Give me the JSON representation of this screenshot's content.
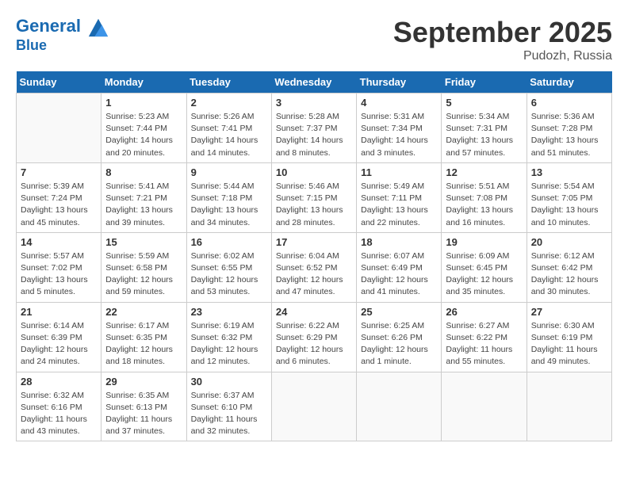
{
  "header": {
    "logo_line1": "General",
    "logo_line2": "Blue",
    "month": "September 2025",
    "location": "Pudozh, Russia"
  },
  "weekdays": [
    "Sunday",
    "Monday",
    "Tuesday",
    "Wednesday",
    "Thursday",
    "Friday",
    "Saturday"
  ],
  "weeks": [
    [
      {
        "day": "",
        "info": ""
      },
      {
        "day": "1",
        "info": "Sunrise: 5:23 AM\nSunset: 7:44 PM\nDaylight: 14 hours\nand 20 minutes."
      },
      {
        "day": "2",
        "info": "Sunrise: 5:26 AM\nSunset: 7:41 PM\nDaylight: 14 hours\nand 14 minutes."
      },
      {
        "day": "3",
        "info": "Sunrise: 5:28 AM\nSunset: 7:37 PM\nDaylight: 14 hours\nand 8 minutes."
      },
      {
        "day": "4",
        "info": "Sunrise: 5:31 AM\nSunset: 7:34 PM\nDaylight: 14 hours\nand 3 minutes."
      },
      {
        "day": "5",
        "info": "Sunrise: 5:34 AM\nSunset: 7:31 PM\nDaylight: 13 hours\nand 57 minutes."
      },
      {
        "day": "6",
        "info": "Sunrise: 5:36 AM\nSunset: 7:28 PM\nDaylight: 13 hours\nand 51 minutes."
      }
    ],
    [
      {
        "day": "7",
        "info": "Sunrise: 5:39 AM\nSunset: 7:24 PM\nDaylight: 13 hours\nand 45 minutes."
      },
      {
        "day": "8",
        "info": "Sunrise: 5:41 AM\nSunset: 7:21 PM\nDaylight: 13 hours\nand 39 minutes."
      },
      {
        "day": "9",
        "info": "Sunrise: 5:44 AM\nSunset: 7:18 PM\nDaylight: 13 hours\nand 34 minutes."
      },
      {
        "day": "10",
        "info": "Sunrise: 5:46 AM\nSunset: 7:15 PM\nDaylight: 13 hours\nand 28 minutes."
      },
      {
        "day": "11",
        "info": "Sunrise: 5:49 AM\nSunset: 7:11 PM\nDaylight: 13 hours\nand 22 minutes."
      },
      {
        "day": "12",
        "info": "Sunrise: 5:51 AM\nSunset: 7:08 PM\nDaylight: 13 hours\nand 16 minutes."
      },
      {
        "day": "13",
        "info": "Sunrise: 5:54 AM\nSunset: 7:05 PM\nDaylight: 13 hours\nand 10 minutes."
      }
    ],
    [
      {
        "day": "14",
        "info": "Sunrise: 5:57 AM\nSunset: 7:02 PM\nDaylight: 13 hours\nand 5 minutes."
      },
      {
        "day": "15",
        "info": "Sunrise: 5:59 AM\nSunset: 6:58 PM\nDaylight: 12 hours\nand 59 minutes."
      },
      {
        "day": "16",
        "info": "Sunrise: 6:02 AM\nSunset: 6:55 PM\nDaylight: 12 hours\nand 53 minutes."
      },
      {
        "day": "17",
        "info": "Sunrise: 6:04 AM\nSunset: 6:52 PM\nDaylight: 12 hours\nand 47 minutes."
      },
      {
        "day": "18",
        "info": "Sunrise: 6:07 AM\nSunset: 6:49 PM\nDaylight: 12 hours\nand 41 minutes."
      },
      {
        "day": "19",
        "info": "Sunrise: 6:09 AM\nSunset: 6:45 PM\nDaylight: 12 hours\nand 35 minutes."
      },
      {
        "day": "20",
        "info": "Sunrise: 6:12 AM\nSunset: 6:42 PM\nDaylight: 12 hours\nand 30 minutes."
      }
    ],
    [
      {
        "day": "21",
        "info": "Sunrise: 6:14 AM\nSunset: 6:39 PM\nDaylight: 12 hours\nand 24 minutes."
      },
      {
        "day": "22",
        "info": "Sunrise: 6:17 AM\nSunset: 6:35 PM\nDaylight: 12 hours\nand 18 minutes."
      },
      {
        "day": "23",
        "info": "Sunrise: 6:19 AM\nSunset: 6:32 PM\nDaylight: 12 hours\nand 12 minutes."
      },
      {
        "day": "24",
        "info": "Sunrise: 6:22 AM\nSunset: 6:29 PM\nDaylight: 12 hours\nand 6 minutes."
      },
      {
        "day": "25",
        "info": "Sunrise: 6:25 AM\nSunset: 6:26 PM\nDaylight: 12 hours\nand 1 minute."
      },
      {
        "day": "26",
        "info": "Sunrise: 6:27 AM\nSunset: 6:22 PM\nDaylight: 11 hours\nand 55 minutes."
      },
      {
        "day": "27",
        "info": "Sunrise: 6:30 AM\nSunset: 6:19 PM\nDaylight: 11 hours\nand 49 minutes."
      }
    ],
    [
      {
        "day": "28",
        "info": "Sunrise: 6:32 AM\nSunset: 6:16 PM\nDaylight: 11 hours\nand 43 minutes."
      },
      {
        "day": "29",
        "info": "Sunrise: 6:35 AM\nSunset: 6:13 PM\nDaylight: 11 hours\nand 37 minutes."
      },
      {
        "day": "30",
        "info": "Sunrise: 6:37 AM\nSunset: 6:10 PM\nDaylight: 11 hours\nand 32 minutes."
      },
      {
        "day": "",
        "info": ""
      },
      {
        "day": "",
        "info": ""
      },
      {
        "day": "",
        "info": ""
      },
      {
        "day": "",
        "info": ""
      }
    ]
  ]
}
